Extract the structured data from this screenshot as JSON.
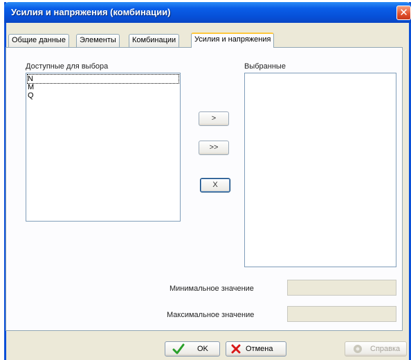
{
  "window": {
    "title": "Усилия и напряжения (комбинации)",
    "close_glyph": "✕"
  },
  "tabs": [
    {
      "label": "Общие данные",
      "active": false
    },
    {
      "label": "Элементы",
      "active": false
    },
    {
      "label": "Комбинации",
      "active": false
    },
    {
      "label": "Усилия и напряжения",
      "active": true
    }
  ],
  "available": {
    "label": "Доступные для выбора",
    "items": [
      "N",
      "M",
      "Q"
    ],
    "selected_index": 0
  },
  "selected": {
    "label": "Выбранные",
    "items": []
  },
  "transfer_buttons": {
    "add_one": ">",
    "add_all": ">>",
    "remove": "X"
  },
  "range": {
    "min_label": "Минимальное значение",
    "min_value": "",
    "max_label": "Максимальное значение",
    "max_value": ""
  },
  "footer": {
    "ok_label": "OK",
    "cancel_label": "Отмена",
    "help_label": "Справка"
  },
  "colors": {
    "ok_check": "#2aa02a",
    "cancel_x": "#d81818",
    "title_bar": "#0a5ee8"
  },
  "icons": {
    "ok": "check-icon",
    "cancel": "cross-icon",
    "help": "help-icon"
  }
}
